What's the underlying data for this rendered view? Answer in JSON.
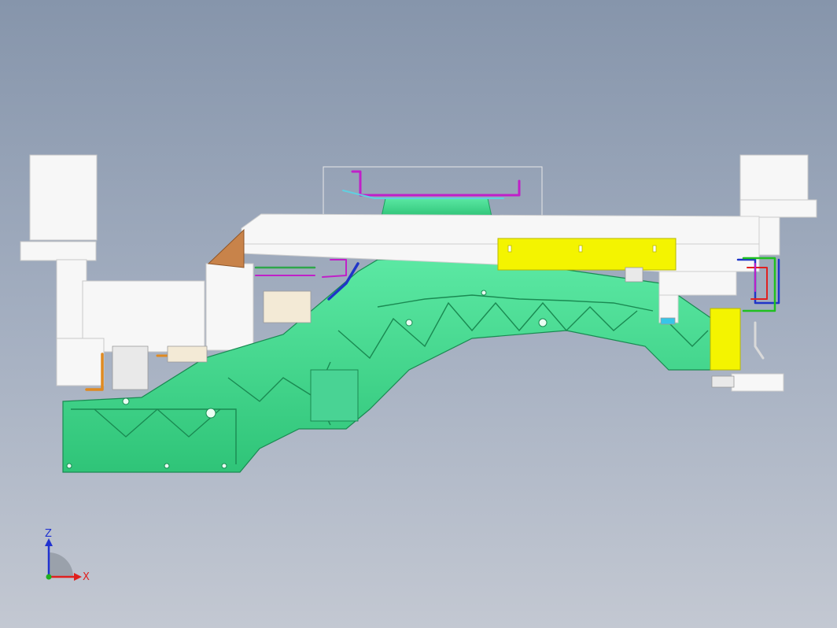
{
  "view": {
    "background_top": "#8695ab",
    "background_bottom": "#c3c8d2"
  },
  "colors": {
    "part_green": "#3fdc8c",
    "part_green_dark": "#1f9f5f",
    "part_white": "#f7f7f7",
    "part_yellow": "#f4f400",
    "part_orange": "#c8834a",
    "pipe_blue": "#1f35c8",
    "pipe_magenta": "#c020c8",
    "pipe_red": "#e02020",
    "axis_x": "#e0201e",
    "axis_z": "#2032d0"
  },
  "triad": {
    "z_label": "Z",
    "x_label": "X",
    "icon": "coordinate-triad-icon"
  }
}
